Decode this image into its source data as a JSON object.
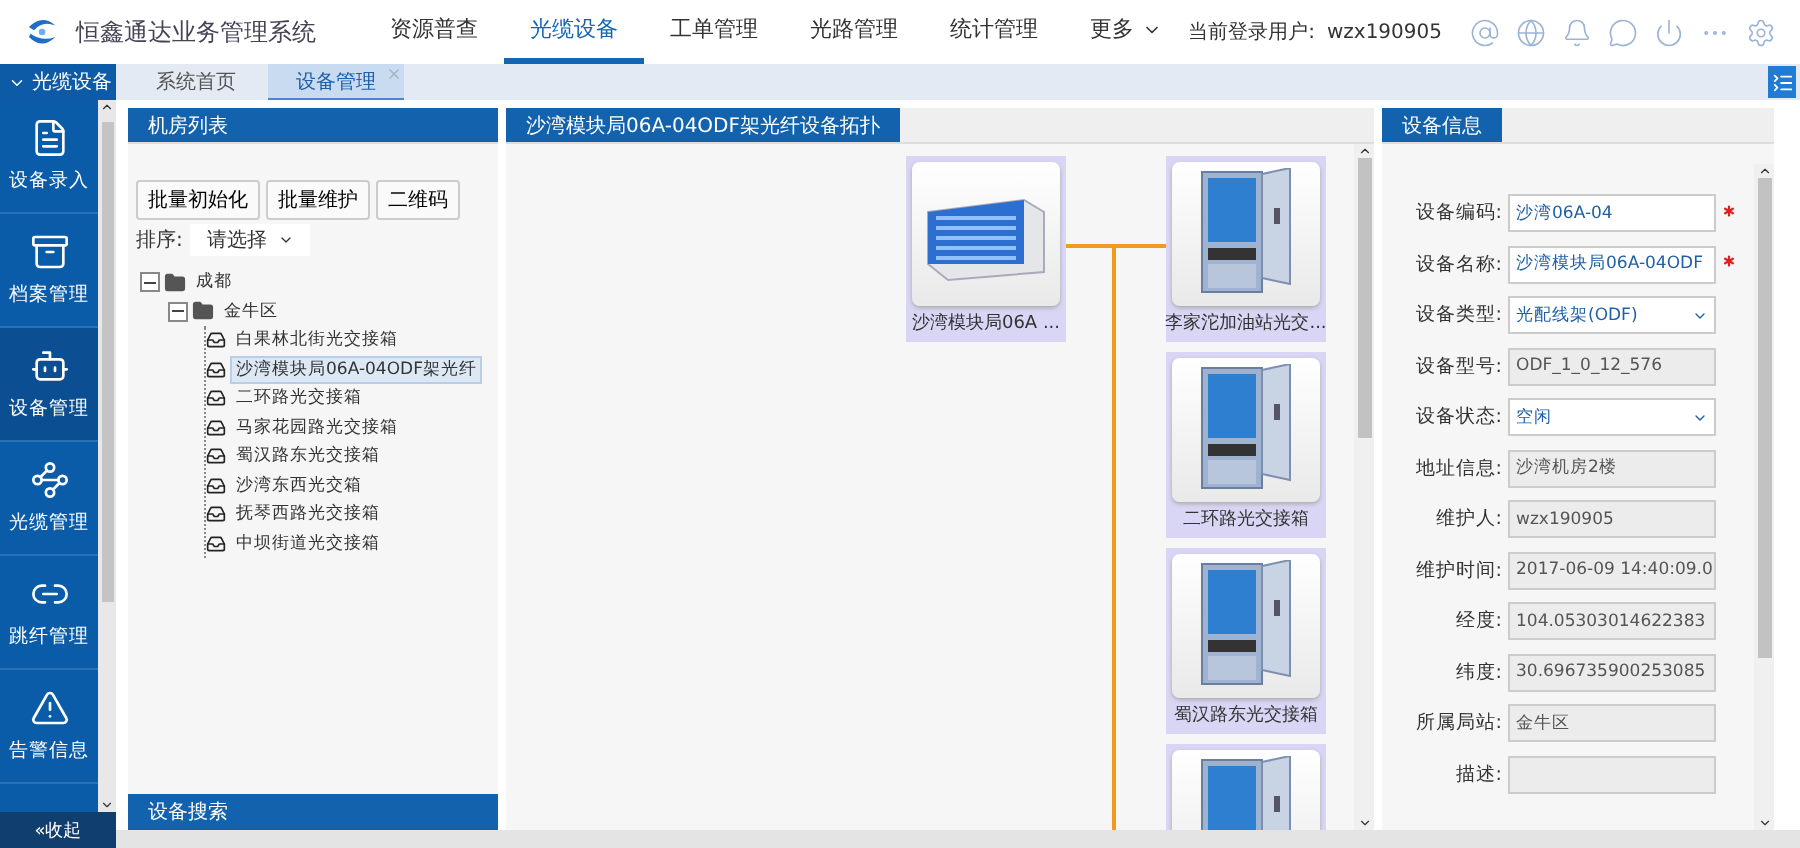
{
  "header": {
    "title": "恒鑫通达业务管理系统",
    "nav": [
      {
        "label": "资源普查",
        "selected": false
      },
      {
        "label": "光缆设备",
        "selected": true
      },
      {
        "label": "工单管理",
        "selected": false
      },
      {
        "label": "光路管理",
        "selected": false
      },
      {
        "label": "统计管理",
        "selected": false
      },
      {
        "label": "更多",
        "selected": false,
        "dropdown": true
      }
    ],
    "user_label": "当前登录用户:",
    "user": "wzx190905"
  },
  "sidebar": {
    "title": "光缆设备",
    "items": [
      {
        "label": "设备录入",
        "selected": false
      },
      {
        "label": "档案管理",
        "selected": false
      },
      {
        "label": "设备管理",
        "selected": true
      },
      {
        "label": "光缆管理",
        "selected": false
      },
      {
        "label": "跳纤管理",
        "selected": false
      },
      {
        "label": "告警信息",
        "selected": false
      }
    ],
    "collapse": "«收起"
  },
  "tabs": [
    {
      "label": "系统首页",
      "selected": false,
      "closable": false
    },
    {
      "label": "设备管理",
      "selected": true,
      "closable": true
    }
  ],
  "room_panel": {
    "title": "机房列表",
    "buttons": [
      "批量初始化",
      "批量维护",
      "二维码"
    ],
    "sort_label": "排序:",
    "sort_value": "请选择",
    "tree": [
      {
        "label": "成都",
        "expanded": true,
        "children": [
          {
            "label": "金牛区",
            "expanded": true,
            "children": [
              {
                "label": "白果林北街光交接箱",
                "selected": false
              },
              {
                "label": "沙湾模块局06A-04ODF架光纤",
                "selected": true
              },
              {
                "label": "二环路光交接箱",
                "selected": false
              },
              {
                "label": "马家花园路光交接箱",
                "selected": false
              },
              {
                "label": "蜀汉路东光交接箱",
                "selected": false
              },
              {
                "label": "沙湾东西光交箱",
                "selected": false
              },
              {
                "label": "抚琴西路光交接箱",
                "selected": false
              },
              {
                "label": "中坝街道光交接箱",
                "selected": false
              }
            ]
          }
        ]
      }
    ],
    "footer": "设备搜索"
  },
  "topology": {
    "title": "沙湾模块局06A-04ODF架光纤设备拓扑",
    "nodes": [
      {
        "kind": "odf",
        "label": "沙湾模块局06A ..."
      },
      {
        "kind": "cabinet",
        "label": "李家沱加油站光交..."
      },
      {
        "kind": "cabinet",
        "label": "二环路光交接箱"
      },
      {
        "kind": "cabinet",
        "label": "蜀汉路东光交接箱"
      },
      {
        "kind": "cabinet"
      }
    ]
  },
  "info": {
    "title": "设备信息",
    "fields": [
      {
        "label": "设备编码:",
        "value": "沙湾06A-04",
        "kind": "text",
        "required": true
      },
      {
        "label": "设备名称:",
        "value": "沙湾模块局06A-04ODF",
        "kind": "text",
        "required": true
      },
      {
        "label": "设备类型:",
        "value": "光配线架(ODF)",
        "kind": "select",
        "required": false
      },
      {
        "label": "设备型号:",
        "value": "ODF_1_0_12_576",
        "kind": "readonly",
        "required": false
      },
      {
        "label": "设备状态:",
        "value": "空闲",
        "kind": "select",
        "required": false
      },
      {
        "label": "地址信息:",
        "value": "沙湾机房2楼",
        "kind": "readonly",
        "required": false
      },
      {
        "label": "维护人:",
        "value": "wzx190905",
        "kind": "readonly",
        "required": false
      },
      {
        "label": "维护时间:",
        "value": "2017-06-09 14:40:09.0",
        "kind": "readonly",
        "required": false
      },
      {
        "label": "经度:",
        "value": "104.05303014622383",
        "kind": "readonly",
        "required": false
      },
      {
        "label": "纬度:",
        "value": "30.696735900253085",
        "kind": "readonly",
        "required": false
      },
      {
        "label": "所属局站:",
        "value": "金牛区",
        "kind": "readonly",
        "required": false
      },
      {
        "label": "描述:",
        "kind": "readonly",
        "required": false
      }
    ]
  }
}
